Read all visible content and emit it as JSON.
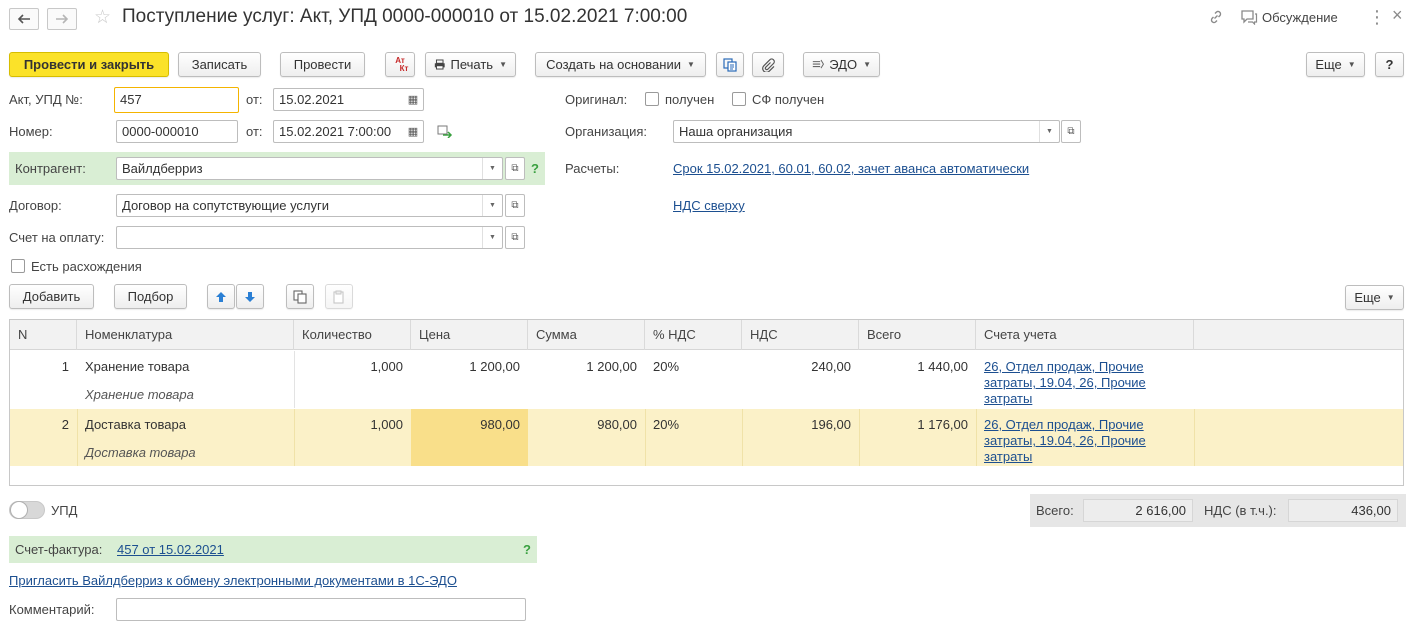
{
  "window": {
    "title": "Поступление услуг: Акт, УПД 0000-000010 от 15.02.2021 7:00:00",
    "discussion_label": "Обсуждение"
  },
  "toolbar": {
    "post_close": "Провести и закрыть",
    "save": "Записать",
    "post": "Провести",
    "dtkt_top": "Ат",
    "dtkt_bottom": "Кт",
    "print": "Печать",
    "create_based": "Создать на основании",
    "edo": "ЭДО",
    "more": "Еще",
    "help": "?"
  },
  "form": {
    "act_label": "Акт, УПД №:",
    "act_value": "457",
    "from_label": "от:",
    "act_date": "15.02.2021",
    "number_label": "Номер:",
    "number_value": "0000-000010",
    "from_label2": "от:",
    "number_date": "15.02.2021  7:00:00",
    "original_label": "Оригинал:",
    "received_label": "получен",
    "sf_received_label": "СФ получен",
    "org_label": "Организация:",
    "org_value": "Наша организация",
    "counterparty_label": "Контрагент:",
    "counterparty_value": "Вайлдберриз",
    "counterparty_help": "?",
    "settlements_label": "Расчеты:",
    "settlements_link": "Срок 15.02.2021, 60.01, 60.02, зачет аванса автоматически",
    "contract_label": "Договор:",
    "contract_value": "Договор на сопутствующие услуги",
    "vat_link": "НДС сверху",
    "invoice_label": "Счет на оплату:",
    "invoice_value": "",
    "discrepancy_label": "Есть расхождения"
  },
  "table_toolbar": {
    "add": "Добавить",
    "pick": "Подбор",
    "more": "Еще"
  },
  "table": {
    "columns": [
      "N",
      "Номенклатура",
      "Количество",
      "Цена",
      "Сумма",
      "% НДС",
      "НДС",
      "Всего",
      "Счета учета"
    ],
    "rows": [
      {
        "n": "1",
        "name": "Хранение товара",
        "subname": "Хранение товара",
        "qty": "1,000",
        "price": "1 200,00",
        "sum": "1 200,00",
        "vat_rate": "20%",
        "vat": "240,00",
        "total": "1 440,00",
        "accounts": [
          "26, Отдел продаж, Прочие",
          "затраты, 19.04, 26, Прочие",
          "затраты"
        ]
      },
      {
        "n": "2",
        "name": "Доставка товара",
        "subname": "Доставка товара",
        "qty": "1,000",
        "price": "980,00",
        "sum": "980,00",
        "vat_rate": "20%",
        "vat": "196,00",
        "total": "1 176,00",
        "accounts": [
          "26, Отдел продаж, Прочие",
          "затраты, 19.04, 26, Прочие",
          "затраты"
        ]
      }
    ]
  },
  "footer": {
    "upd_label": "УПД",
    "total_label": "Всего:",
    "total_value": "2 616,00",
    "vat_label": "НДС (в т.ч.):",
    "vat_value": "436,00",
    "invoice_label": "Счет-фактура:",
    "invoice_link": "457 от 15.02.2021",
    "invoice_help": "?",
    "invite_link": "Пригласить Вайлдберриз к обмену электронными документами в 1С-ЭДО",
    "comment_label": "Комментарий:",
    "comment_value": ""
  }
}
